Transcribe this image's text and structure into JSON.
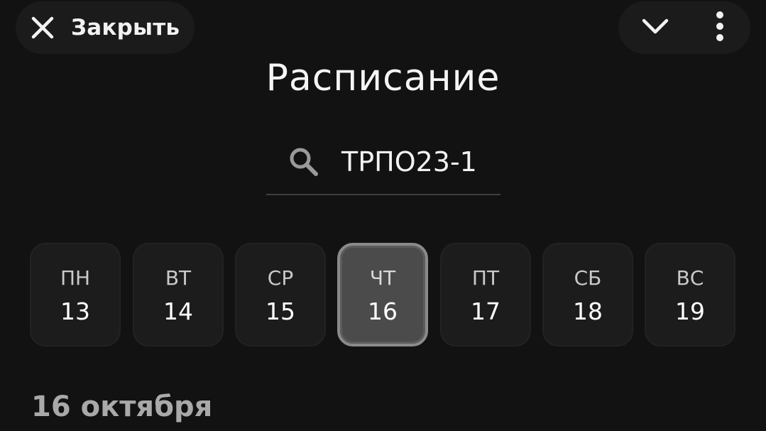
{
  "header": {
    "close_label": "Закрыть",
    "close_icon": "close-icon",
    "dropdown_icon": "chevron-down-icon",
    "more_icon": "more-vertical-icon"
  },
  "title": "Расписание",
  "search": {
    "icon": "search-icon",
    "value": "ТРПО23-1"
  },
  "week": {
    "days": [
      {
        "dow": "ПН",
        "date": "13",
        "selected": false
      },
      {
        "dow": "ВТ",
        "date": "14",
        "selected": false
      },
      {
        "dow": "СР",
        "date": "15",
        "selected": false
      },
      {
        "dow": "ЧТ",
        "date": "16",
        "selected": true
      },
      {
        "dow": "ПТ",
        "date": "17",
        "selected": false
      },
      {
        "dow": "СБ",
        "date": "18",
        "selected": false
      },
      {
        "dow": "ВС",
        "date": "19",
        "selected": false
      }
    ]
  },
  "selected_date_label": "16 октября",
  "colors": {
    "background": "#121212",
    "pill": "#1b1b1b",
    "day_card": "#1c1c1c",
    "day_selected": "#4b4b4b",
    "date_header_text": "#a9a9a9"
  }
}
